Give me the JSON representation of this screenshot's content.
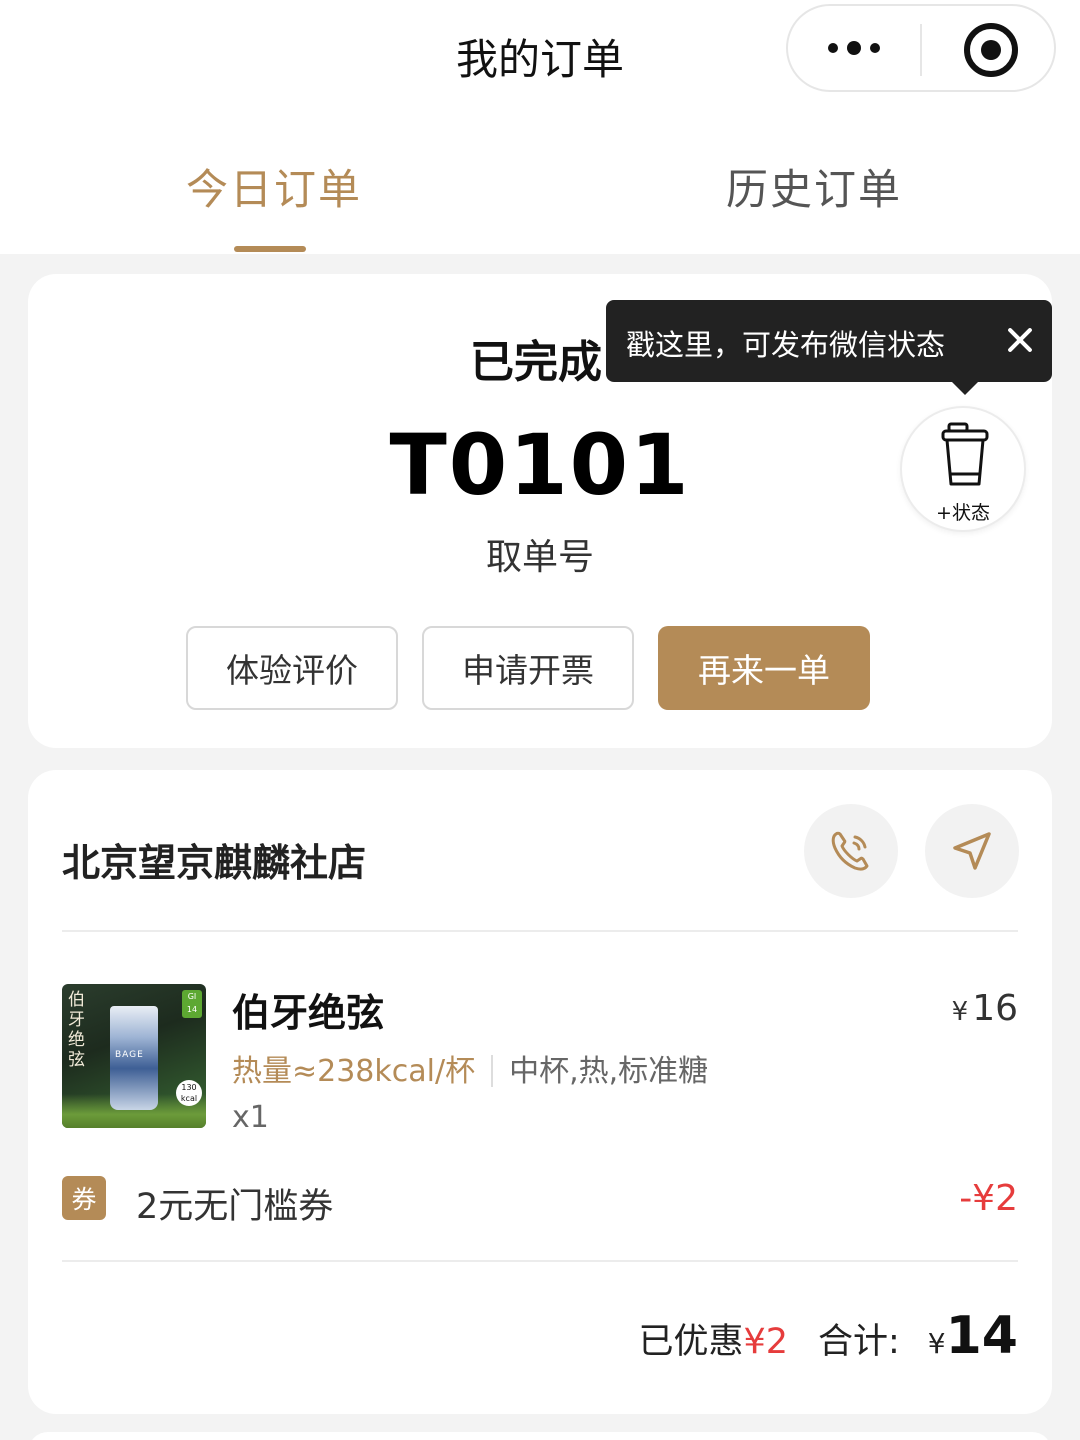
{
  "header": {
    "title": "我的订单"
  },
  "tabs": [
    {
      "label": "今日订单",
      "active": true
    },
    {
      "label": "历史订单",
      "active": false
    }
  ],
  "order": {
    "status": "已完成",
    "number": "T0101",
    "number_label": "取单号",
    "actions": [
      "体验评价",
      "申请开票",
      "再来一单"
    ]
  },
  "tooltip": {
    "text": "戳这里，可发布微信状态"
  },
  "state_button": {
    "label": "+状态"
  },
  "store": {
    "name": "北京望京麒麟社店"
  },
  "product": {
    "name": "伯牙绝弦",
    "image_text": "伯牙绝弦",
    "currency": "¥",
    "price": "16",
    "calories": "热量≈238kcal/杯",
    "spec": "中杯,热,标准糖",
    "quantity": "x1"
  },
  "coupon": {
    "badge": "券",
    "name": "2元无门槛券",
    "amount": "-¥2"
  },
  "summary": {
    "discount_label": "已优惠",
    "discount_amount": "¥2",
    "total_label": "合计:",
    "currency": "¥",
    "total": "14"
  },
  "colors": {
    "accent": "#b48b57",
    "discount_red": "#e63c3c",
    "background": "#f3f3f3"
  }
}
